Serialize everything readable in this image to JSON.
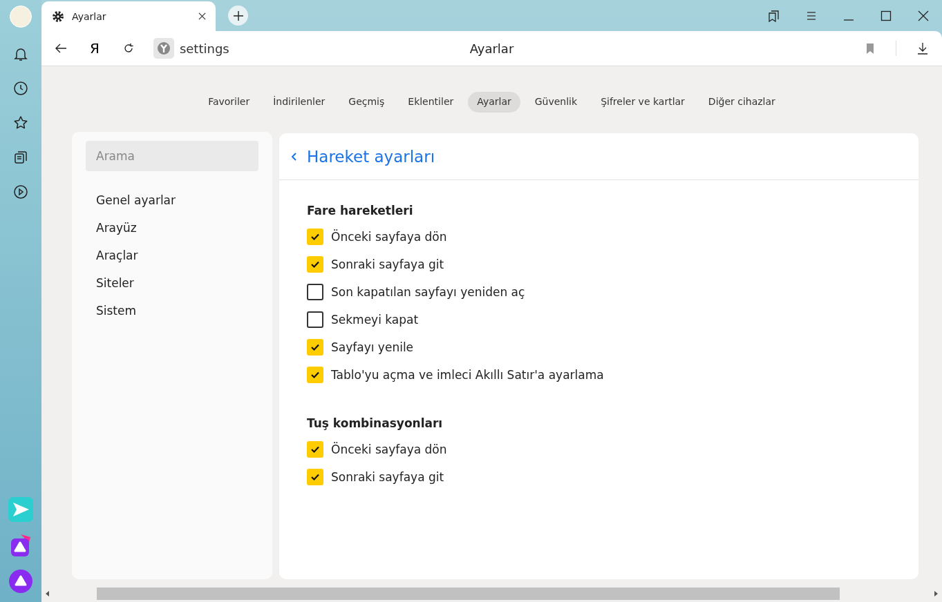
{
  "browser_tab": {
    "title": "Ayarlar"
  },
  "toolbar": {
    "logo_glyph": "Я",
    "address": "settings",
    "page_title": "Ayarlar"
  },
  "nav_tabs": [
    {
      "label": "Favoriler",
      "selected": false
    },
    {
      "label": "İndirilenler",
      "selected": false
    },
    {
      "label": "Geçmiş",
      "selected": false
    },
    {
      "label": "Eklentiler",
      "selected": false
    },
    {
      "label": "Ayarlar",
      "selected": true
    },
    {
      "label": "Güvenlik",
      "selected": false
    },
    {
      "label": "Şifreler ve kartlar",
      "selected": false
    },
    {
      "label": "Diğer cihazlar",
      "selected": false
    }
  ],
  "sidebar": {
    "search": {
      "placeholder": "Arama"
    },
    "items": [
      "Genel ayarlar",
      "Arayüz",
      "Araçlar",
      "Siteler",
      "Sistem"
    ]
  },
  "panel": {
    "title": "Hareket ayarları",
    "sections": [
      {
        "heading": "Fare hareketleri",
        "options": [
          {
            "label": "Önceki sayfaya dön",
            "checked": true
          },
          {
            "label": "Sonraki sayfaya git",
            "checked": true
          },
          {
            "label": "Son kapatılan sayfayı yeniden aç",
            "checked": false
          },
          {
            "label": "Sekmeyi kapat",
            "checked": false
          },
          {
            "label": "Sayfayı yenile",
            "checked": true
          },
          {
            "label": "Tablo'yu açma ve imleci Akıllı Satır'a ayarlama",
            "checked": true
          }
        ]
      },
      {
        "heading": "Tuş kombinasyonları",
        "options": [
          {
            "label": "Önceki sayfaya dön",
            "checked": true
          },
          {
            "label": "Sonraki sayfaya git",
            "checked": true
          }
        ]
      }
    ]
  }
}
